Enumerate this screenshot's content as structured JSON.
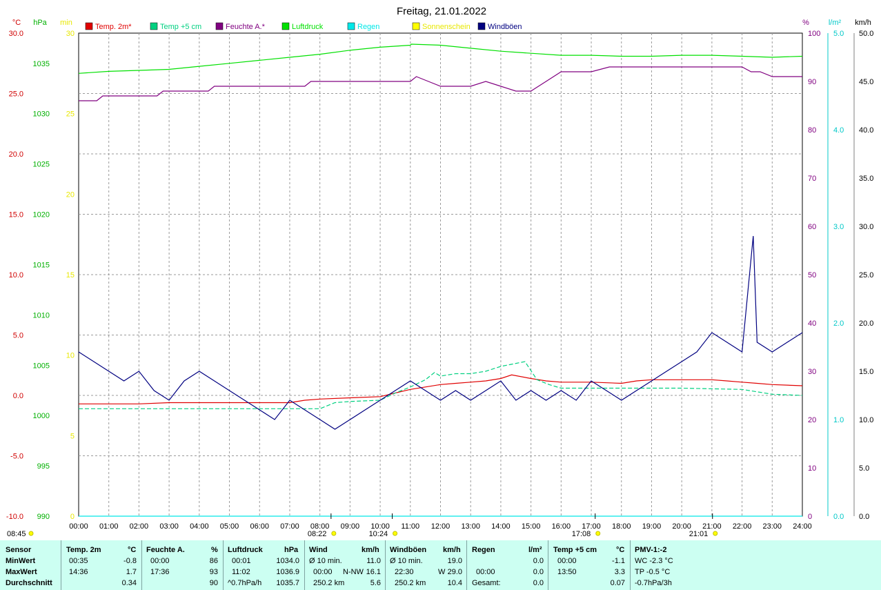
{
  "title": "Freitag, 21.01.2022",
  "legend": [
    {
      "label": "Temp. 2m*",
      "color": "#e00000"
    },
    {
      "label": "Temp +5 cm",
      "color": "#00d080"
    },
    {
      "label": "Feuchte A.*",
      "color": "#800080"
    },
    {
      "label": "Luftdruck",
      "color": "#00e000"
    },
    {
      "label": "Regen",
      "color": "#00e8e8"
    },
    {
      "label": "Sonnenschein",
      "color": "#ffff00"
    },
    {
      "label": "Windböen",
      "color": "#000080"
    }
  ],
  "axis_units": {
    "temp": "°C",
    "pressure": "hPa",
    "sun": "min",
    "humidity": "%",
    "rain": "l/m²",
    "wind": "km/h"
  },
  "axes": {
    "temp": {
      "range": [
        -10,
        30
      ],
      "ticks": [
        "30.0",
        "25.0",
        "20.0",
        "15.0",
        "10.0",
        "5.0",
        "0.0",
        "-5.0",
        "-10.0"
      ],
      "color": "#d00000"
    },
    "pressure": {
      "range": [
        990,
        1038
      ],
      "ticks": [
        "1035",
        "1030",
        "1025",
        "1020",
        "1015",
        "1010",
        "1005",
        "1000",
        "995",
        "990"
      ],
      "color": "#00b000"
    },
    "sun": {
      "range": [
        0,
        30
      ],
      "ticks": [
        "30",
        "25",
        "20",
        "15",
        "10",
        "5",
        "0"
      ],
      "color": "#e8e800"
    },
    "humidity": {
      "range": [
        0,
        100
      ],
      "ticks": [
        "100",
        "90",
        "80",
        "70",
        "60",
        "50",
        "40",
        "30",
        "20",
        "10",
        "0"
      ],
      "color": "#800080"
    },
    "rain": {
      "range": [
        0,
        5
      ],
      "ticks": [
        "5.0",
        "4.0",
        "3.0",
        "2.0",
        "1.0",
        "0.0"
      ],
      "color": "#00c8c8"
    },
    "wind": {
      "range": [
        0,
        50
      ],
      "ticks": [
        "50.0",
        "45.0",
        "40.0",
        "35.0",
        "30.0",
        "25.0",
        "20.0",
        "15.0",
        "10.0",
        "5.0",
        "0.0"
      ],
      "color": "#000000"
    }
  },
  "x_labels": [
    "00:00",
    "01:00",
    "02:00",
    "03:00",
    "04:00",
    "05:00",
    "06:00",
    "07:00",
    "08:00",
    "09:00",
    "10:00",
    "11:00",
    "12:00",
    "13:00",
    "14:00",
    "15:00",
    "16:00",
    "17:00",
    "18:00",
    "19:00",
    "20:00",
    "21:00",
    "22:00",
    "23:00",
    "24:00"
  ],
  "sun_markers": [
    {
      "label": "08:45",
      "hour": null
    },
    {
      "label": "08:22",
      "hour": 8.37
    },
    {
      "label": "10:24",
      "hour": 10.4
    },
    {
      "label": "17:08",
      "hour": 17.13
    },
    {
      "label": "21:01",
      "hour": 21.02
    }
  ],
  "chart_data": {
    "type": "line",
    "title": "Freitag, 21.01.2022",
    "x_unit": "hour",
    "xlim": [
      0,
      24
    ],
    "series": [
      {
        "name": "Temp. 2m*",
        "axis": "temp",
        "x": [
          0,
          1,
          2,
          3,
          4,
          5,
          6,
          7,
          7.5,
          8,
          9,
          10,
          10.5,
          11,
          11.5,
          12,
          12.5,
          13,
          13.5,
          14,
          14.36,
          15,
          15.5,
          16,
          17,
          18,
          18.5,
          19,
          20,
          21,
          21.5,
          22,
          22.5,
          23,
          24
        ],
        "y": [
          -0.7,
          -0.7,
          -0.7,
          -0.6,
          -0.6,
          -0.6,
          -0.6,
          -0.6,
          -0.4,
          -0.3,
          -0.2,
          -0.1,
          0.2,
          0.5,
          0.7,
          0.9,
          1.0,
          1.1,
          1.2,
          1.4,
          1.7,
          1.4,
          1.2,
          1.1,
          1.1,
          1.0,
          1.2,
          1.3,
          1.3,
          1.3,
          1.2,
          1.1,
          1.0,
          0.9,
          0.8
        ]
      },
      {
        "name": "Temp +5 cm",
        "axis": "temp",
        "x": [
          0,
          2,
          4,
          6,
          8,
          8.5,
          9,
          10,
          10.5,
          11,
          11.5,
          11.8,
          12,
          12.5,
          13,
          13.5,
          14,
          14.4,
          14.8,
          15.2,
          15.6,
          16,
          18,
          20,
          22,
          23,
          24
        ],
        "y": [
          -1.1,
          -1.1,
          -1.1,
          -1.1,
          -1.1,
          -0.6,
          -0.5,
          -0.4,
          0.2,
          0.7,
          1.3,
          1.9,
          1.6,
          1.8,
          1.8,
          2.0,
          2.4,
          2.6,
          2.8,
          1.3,
          0.9,
          0.6,
          0.6,
          0.6,
          0.5,
          0.1,
          0.0
        ]
      },
      {
        "name": "Feuchte A.*",
        "axis": "humidity",
        "x": [
          0,
          0.6,
          0.8,
          2.6,
          2.8,
          4.3,
          4.5,
          7.5,
          7.7,
          11,
          11.2,
          11.6,
          12,
          12.5,
          13,
          13.5,
          14,
          14.5,
          15,
          15.5,
          16,
          17,
          17.6,
          18,
          19,
          20,
          21,
          22,
          22.3,
          22.6,
          23,
          23.5,
          24
        ],
        "y": [
          86,
          86,
          87,
          87,
          88,
          88,
          89,
          89,
          90,
          90,
          91,
          90,
          89,
          89,
          89,
          90,
          89,
          88,
          88,
          90,
          92,
          92,
          93,
          93,
          93,
          93,
          93,
          93,
          92,
          92,
          91,
          91,
          91
        ]
      },
      {
        "name": "Luftdruck",
        "axis": "pressure",
        "x": [
          0,
          1,
          2,
          3,
          4,
          5,
          6,
          7,
          8,
          9,
          10,
          11,
          11.03,
          12,
          13,
          14,
          15,
          16,
          17,
          18,
          19,
          20,
          21,
          22,
          23,
          24
        ],
        "y": [
          1034.0,
          1034.2,
          1034.3,
          1034.4,
          1034.7,
          1035.0,
          1035.3,
          1035.6,
          1035.9,
          1036.3,
          1036.6,
          1036.8,
          1036.9,
          1036.8,
          1036.5,
          1036.2,
          1036.0,
          1035.8,
          1035.8,
          1035.7,
          1035.7,
          1035.8,
          1035.8,
          1035.7,
          1035.6,
          1035.7
        ]
      },
      {
        "name": "Regen",
        "axis": "rain",
        "x": [
          0,
          24
        ],
        "y": [
          0.0,
          0.0
        ]
      },
      {
        "name": "Windböen",
        "axis": "wind",
        "x": [
          0,
          0.5,
          1,
          1.5,
          2,
          2.5,
          3,
          3.5,
          4,
          4.5,
          5,
          5.5,
          6,
          6.5,
          7,
          7.5,
          8,
          8.5,
          9,
          9.5,
          10,
          10.5,
          11,
          11.5,
          12,
          12.5,
          13,
          13.5,
          14,
          14.5,
          15,
          15.5,
          16,
          16.5,
          17,
          17.5,
          18,
          18.5,
          19,
          19.5,
          20,
          20.5,
          21,
          21.5,
          22,
          22.37,
          22.5,
          23,
          23.5,
          24
        ],
        "y": [
          17,
          16,
          15,
          14,
          15,
          13,
          12,
          14,
          15,
          14,
          13,
          12,
          11,
          10,
          12,
          11,
          10,
          9,
          10,
          11,
          12,
          13,
          14,
          13,
          12,
          13,
          12,
          13,
          14,
          12,
          13,
          12,
          13,
          12,
          14,
          13,
          12,
          13,
          14,
          15,
          16,
          17,
          19,
          18,
          17,
          29,
          18,
          17,
          18,
          19
        ]
      }
    ],
    "sun_minutes_total": 0
  },
  "stats": {
    "header": [
      "Sensor",
      "Temp. 2m",
      "°C",
      "Feuchte A.",
      "%",
      "Luftdruck",
      "hPa",
      "Wind",
      "km/h",
      "Windböen",
      "km/h",
      "Regen",
      "l/m²",
      "Temp +5 cm",
      "°C",
      "PMV-1:-2"
    ],
    "row_labels": [
      "MinWert",
      "MaxWert",
      "Durchschnitt"
    ],
    "temp2m": {
      "min_time": "00:35",
      "min": "-0.8",
      "max_time": "14:36",
      "max": "1.7",
      "avg": "0.34"
    },
    "feuchte": {
      "min_time": "00:00",
      "min": "86",
      "max_time": "17:36",
      "max": "93",
      "avg": "90"
    },
    "luftdruck": {
      "min_time": "00:01",
      "min": "1034.0",
      "max_time": "11:02",
      "max": "1036.9",
      "trend": "^0.7hPa/h",
      "avg": "1035.7"
    },
    "wind": {
      "r1_label": "Ø 10 min.",
      "r1_val": "11.0",
      "r2_time": "00:00",
      "r2_dir": "N-NW",
      "r2_val": "16.1",
      "r3_dist": "250.2 km",
      "r3_val": "5.6"
    },
    "windboeen": {
      "r1_label": "Ø 10 min.",
      "r1_val": "19.0",
      "r2_time": "22:30",
      "r2_dir": "W",
      "r2_val": "29.0",
      "r3_dist": "250.2 km",
      "r3_val": "10.4"
    },
    "regen": {
      "r2_time": "00:00",
      "r2_val": "0.0",
      "r3_label": "Gesamt:",
      "r1_val": "0.0",
      "r3_val": "0.0"
    },
    "temp5cm": {
      "min_time": "00:00",
      "min": "-1.1",
      "max_time": "13:50",
      "max": "3.3",
      "avg": "0.07"
    },
    "pmv": {
      "r1": "WC -2.3 °C",
      "r2": "TP -0.5 °C",
      "r3": "-0.7hPa/3h"
    }
  }
}
